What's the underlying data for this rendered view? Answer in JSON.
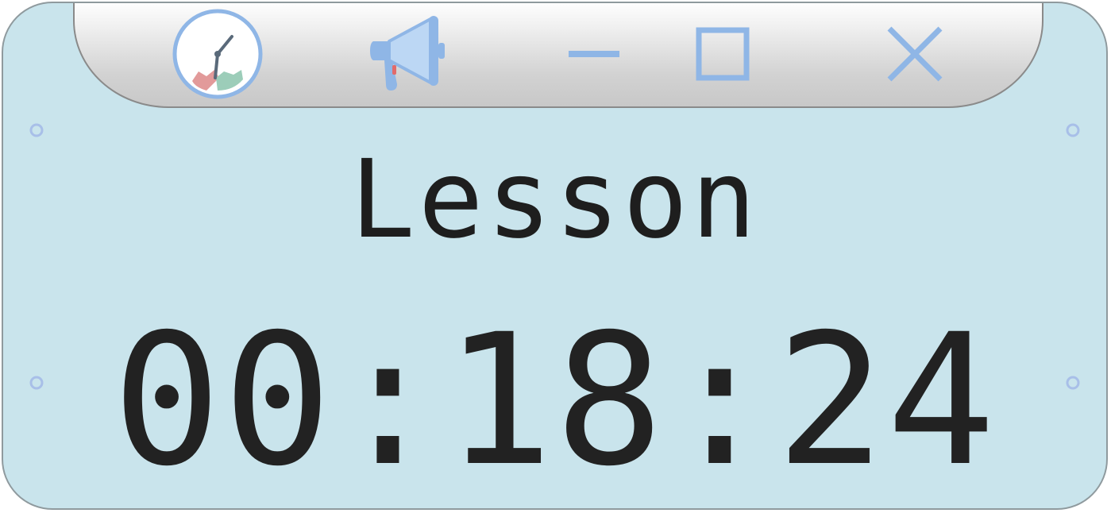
{
  "widget": {
    "label": "Lesson",
    "time": "00:18:24"
  },
  "titlebar": {
    "buttons": [
      {
        "name": "clock-icon"
      },
      {
        "name": "megaphone-icon"
      },
      {
        "name": "minimize-icon"
      },
      {
        "name": "maximize-icon"
      },
      {
        "name": "close-icon"
      }
    ]
  },
  "colors": {
    "background": "#c9e4ec",
    "titlebar": "#d2d2d2",
    "accent": "#8fb6e6",
    "text": "#222222"
  }
}
